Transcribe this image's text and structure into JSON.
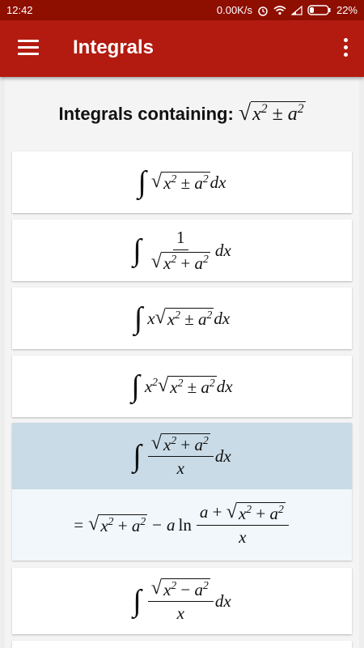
{
  "status_bar": {
    "time": "12:42",
    "speed": "0.00K/s",
    "battery": "22%"
  },
  "app_bar": {
    "title": "Integrals"
  },
  "heading": {
    "text": "Integrals containing:"
  },
  "integrals": [
    {
      "label": "integral of sqrt(x^2 ± a^2) dx"
    },
    {
      "label": "integral of 1/sqrt(x^2 + a^2) dx"
    },
    {
      "label": "integral of x sqrt(x^2 ± a^2) dx"
    },
    {
      "label": "integral of x^2 sqrt(x^2 ± a^2) dx"
    },
    {
      "label": "integral of sqrt(x^2 + a^2)/x dx",
      "selected": true
    },
    {
      "label": "integral of sqrt(x^2 - a^2)/x dx"
    }
  ],
  "expansion": {
    "label": "= sqrt(x^2 + a^2) - a ln((a + sqrt(x^2 + a^2))/x)"
  },
  "colors": {
    "status_bar": "#8e0e00",
    "app_bar": "#b31b10",
    "selected": "#c9dbe6"
  },
  "icons": [
    "menu-icon",
    "more-vert-icon",
    "alarm-icon",
    "wifi-icon",
    "signal-icon",
    "battery-icon"
  ]
}
